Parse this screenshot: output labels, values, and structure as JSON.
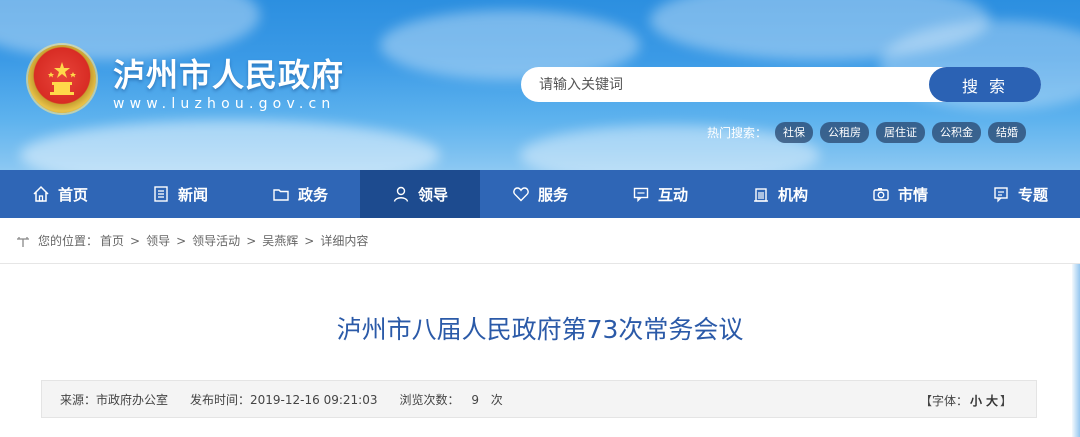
{
  "header": {
    "title": "泸州市人民政府",
    "domain": "www.luzhou.gov.cn",
    "emblem_icon": "national-emblem-icon"
  },
  "search": {
    "placeholder": "请输入关键词",
    "button_label": "搜 索"
  },
  "hot_search": {
    "label": "热门搜索：",
    "tags": [
      "社保",
      "公租房",
      "居住证",
      "公积金",
      "结婚"
    ]
  },
  "nav": {
    "items": [
      {
        "label": "首页",
        "icon": "home-icon"
      },
      {
        "label": "新闻",
        "icon": "news-icon"
      },
      {
        "label": "政务",
        "icon": "folder-icon"
      },
      {
        "label": "领导",
        "icon": "user-icon"
      },
      {
        "label": "服务",
        "icon": "heart-icon"
      },
      {
        "label": "互动",
        "icon": "chat-icon"
      },
      {
        "label": "机构",
        "icon": "building-icon"
      },
      {
        "label": "市情",
        "icon": "camera-icon"
      },
      {
        "label": "专题",
        "icon": "topic-icon"
      }
    ],
    "active_index": 3
  },
  "breadcrumb": {
    "prefix": "您的位置：",
    "items": [
      "首页",
      "领导",
      "领导活动",
      "吴燕辉",
      "详细内容"
    ],
    "separator": ">"
  },
  "article": {
    "title": "泸州市八届人民政府第73次常务会议",
    "source": "来源：市政府办公室",
    "publish_time": "发布时间：2019-12-16 09:21:03",
    "views_label": "浏览次数：",
    "views_count": "9",
    "views_unit": "次",
    "font_label": "【字体：",
    "font_small": "小",
    "font_large": "大",
    "font_close": "】"
  },
  "colors": {
    "nav_bg": "#2f66b6",
    "nav_active": "#1d4b8f",
    "title_blue": "#2b5aa8",
    "search_button": "#2b62b4"
  }
}
